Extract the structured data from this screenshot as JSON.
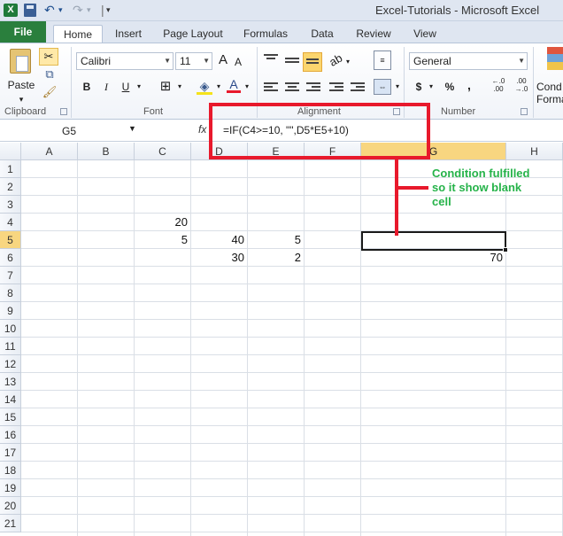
{
  "window": {
    "title": "Excel-Tutorials  -  Microsoft Excel",
    "logo_letter": "X"
  },
  "tabs": [
    "File",
    "Home",
    "Insert",
    "Page Layout",
    "Formulas",
    "Data",
    "Review",
    "View"
  ],
  "ribbon": {
    "clipboard": {
      "label": "Clipboard",
      "paste_label": "Paste"
    },
    "font": {
      "label": "Font",
      "name": "Calibri",
      "size": "11",
      "bold": "B",
      "italic": "I",
      "underline": "U",
      "grow": "A",
      "shrink": "A",
      "font_color": "A"
    },
    "alignment": {
      "label": "Alignment"
    },
    "number": {
      "label": "Number",
      "format": "General",
      "currency": "$",
      "percent": "%",
      "comma": ",",
      "inc_dec": "←.0\n.00",
      "dec_dec": ".00\n→.0"
    },
    "partial_label_1": "Cond",
    "partial_label_2": "Forma"
  },
  "formula_bar": {
    "name_box": "G5",
    "fx": "fx",
    "formula": "=IF(C4>=10, \"\",D5*E5+10)"
  },
  "columns": [
    "A",
    "B",
    "C",
    "D",
    "E",
    "F",
    "G",
    "H"
  ],
  "rows": [
    "1",
    "2",
    "3",
    "4",
    "5",
    "6",
    "7",
    "8",
    "9",
    "10",
    "11",
    "12",
    "13",
    "14",
    "15",
    "16",
    "17",
    "18",
    "19",
    "20",
    "21"
  ],
  "cells": {
    "C4": "20",
    "C5": "5",
    "D5": "40",
    "E5": "5",
    "D6": "30",
    "E6": "2",
    "G6": "70"
  },
  "selected": {
    "column": "G",
    "row": "5"
  },
  "annotation": {
    "line1": "Condition fulfilled",
    "line2": "so it show blank",
    "line3": "cell",
    "color": "#26b34a",
    "box_color": "#e8192c"
  }
}
